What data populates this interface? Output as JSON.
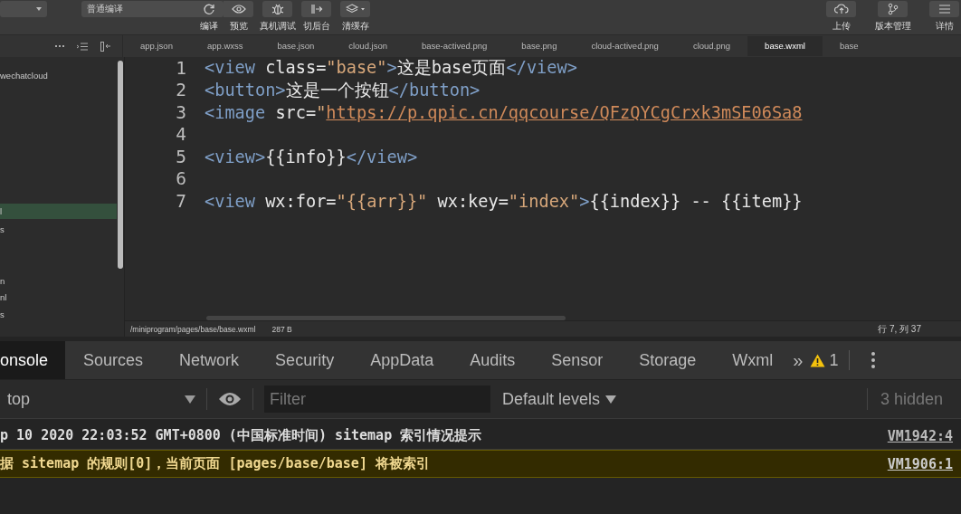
{
  "toolbar": {
    "mode_select": "普通编译",
    "tools": [
      {
        "kind": "refresh",
        "label": "编译"
      },
      {
        "kind": "eye",
        "label": "预览"
      },
      {
        "kind": "bug",
        "label": "真机调试"
      },
      {
        "kind": "switch",
        "label": "切后台"
      },
      {
        "kind": "layers",
        "label": "清缓存"
      }
    ],
    "right_tools": [
      {
        "kind": "cloud",
        "label": "上传"
      },
      {
        "kind": "branch",
        "label": "版本管理"
      },
      {
        "kind": "menu",
        "label": "详情"
      }
    ]
  },
  "file_tabs": [
    {
      "label": "app.json",
      "selected": false
    },
    {
      "label": "app.wxss",
      "selected": false
    },
    {
      "label": "base.json",
      "selected": false
    },
    {
      "label": "cloud.json",
      "selected": false
    },
    {
      "label": "base-actived.png",
      "selected": false
    },
    {
      "label": "base.png",
      "selected": false
    },
    {
      "label": "cloud-actived.png",
      "selected": false
    },
    {
      "label": "cloud.png",
      "selected": false
    },
    {
      "label": "base.wxml",
      "selected": true
    },
    {
      "label": "base",
      "selected": false
    }
  ],
  "sidebar": {
    "items": [
      {
        "label": "wechatcloud",
        "selected": false
      },
      {
        "label": "l",
        "selected": true
      },
      {
        "label": "s",
        "selected": false
      },
      {
        "label": "n",
        "selected": false
      },
      {
        "label": "nl",
        "selected": false
      },
      {
        "label": "s",
        "selected": false
      }
    ]
  },
  "code": [
    {
      "number": "1",
      "tokens": [
        {
          "kind": "tag",
          "text": "<view "
        },
        {
          "kind": "attr",
          "text": "class="
        },
        {
          "kind": "string",
          "text": "\"base\""
        },
        {
          "kind": "tag",
          "text": ">"
        },
        {
          "kind": "text",
          "text": "这是base页面"
        },
        {
          "kind": "tag",
          "text": "</view>"
        }
      ]
    },
    {
      "number": "2",
      "tokens": [
        {
          "kind": "tag",
          "text": "<button>"
        },
        {
          "kind": "text",
          "text": "这是一个按钮"
        },
        {
          "kind": "tag",
          "text": "</button>"
        }
      ]
    },
    {
      "number": "3",
      "tokens": [
        {
          "kind": "tag",
          "text": "<image "
        },
        {
          "kind": "attr",
          "text": "src="
        },
        {
          "kind": "string",
          "text": "\""
        },
        {
          "kind": "link",
          "text": "https://p.qpic.cn/qqcourse/QFzQYCgCrxk3mSE06Sa8"
        }
      ]
    },
    {
      "number": "4"
    },
    {
      "number": "5",
      "tokens": [
        {
          "kind": "tag",
          "text": "<view>"
        },
        {
          "kind": "text",
          "text": "{{info}}"
        },
        {
          "kind": "tag",
          "text": "</view>"
        }
      ]
    },
    {
      "number": "6"
    },
    {
      "number": "7",
      "tokens": [
        {
          "kind": "tag",
          "text": "<view "
        },
        {
          "kind": "attr",
          "text": "wx:for="
        },
        {
          "kind": "string",
          "text": "\"{{arr}}\""
        },
        {
          "kind": "attr",
          "text": " wx:key="
        },
        {
          "kind": "string",
          "text": "\"index\""
        },
        {
          "kind": "tag",
          "text": ">"
        },
        {
          "kind": "text",
          "text": "{{index}} -- {{item}}"
        }
      ]
    }
  ],
  "status_bar": {
    "path": "/miniprogram/pages/base/base.wxml",
    "size": "287 B",
    "position": "行 7, 列 37"
  },
  "devtools": {
    "tabs": [
      {
        "label": "onsole",
        "selected": true
      },
      {
        "label": "Sources",
        "selected": false
      },
      {
        "label": "Network",
        "selected": false
      },
      {
        "label": "Security",
        "selected": false
      },
      {
        "label": "AppData",
        "selected": false
      },
      {
        "label": "Audits",
        "selected": false
      },
      {
        "label": "Sensor",
        "selected": false
      },
      {
        "label": "Storage",
        "selected": false
      },
      {
        "label": "Wxml",
        "selected": false
      }
    ],
    "more": "»",
    "warnings": "1",
    "context": "top",
    "filter_placeholder": "Filter",
    "levels": "Default levels",
    "hidden": "3 hidden",
    "messages": [
      {
        "kind": "info",
        "text": "p 10 2020 22:03:52 GMT+0800 (中国标准时间) sitemap 索引情况提示",
        "source": "VM1942:4"
      },
      {
        "kind": "warning",
        "text": "据 sitemap 的规则[0]，当前页面 [pages/base/base] 将被索引",
        "source": "VM1906:1"
      }
    ]
  }
}
